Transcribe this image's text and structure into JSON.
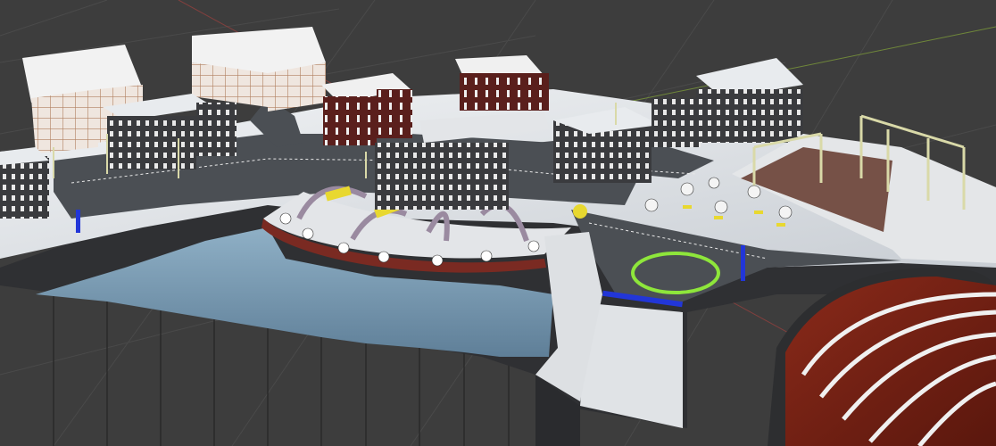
{
  "viewport": {
    "kind": "3d-viewport",
    "scene_description_visible_text": "",
    "colors": {
      "background": "#3d3d3d",
      "grid_line": "#4a4a4a",
      "axis_x": "#b0413e",
      "axis_y": "#7c9a3a",
      "snow": "#e8ebee",
      "asphalt": "#4b4f54",
      "building_dark": "#3a3b3e",
      "brick": "#5a1f1c",
      "water": "#6f8fa8",
      "blue_marker": "#2236d8",
      "green_ring": "#8ee63b",
      "yellow_prop": "#e8d830",
      "pole": "#d9d9a8",
      "dome_red": "#7a2417",
      "arch_purple": "#9a8aa0"
    }
  }
}
